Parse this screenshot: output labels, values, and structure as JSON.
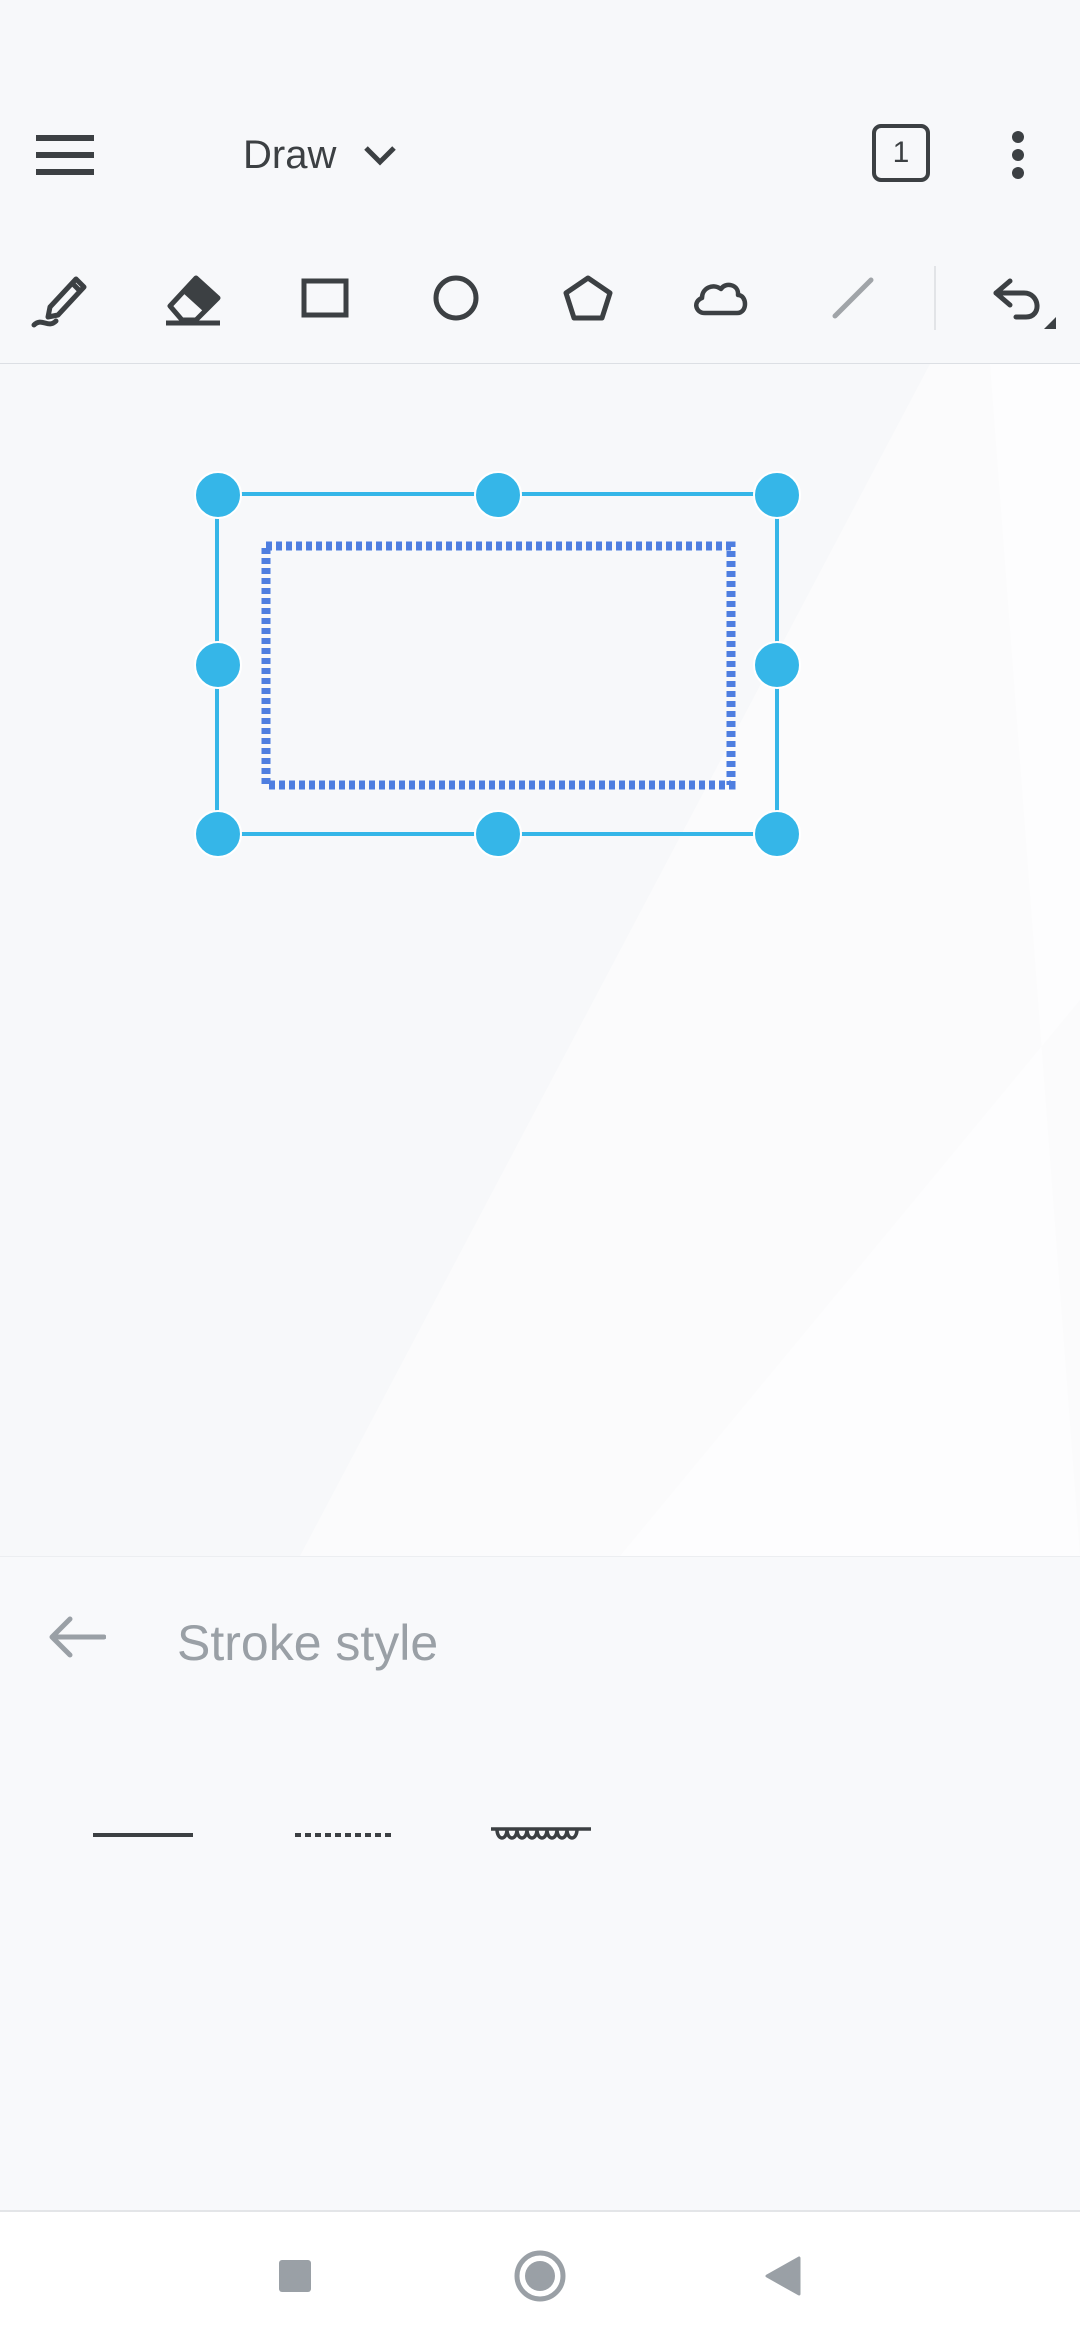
{
  "app": {
    "mode_title": "Draw",
    "page_count": "1"
  },
  "toolbar": {
    "tools": [
      "pen",
      "eraser",
      "rectangle",
      "ellipse",
      "polygon",
      "cloud",
      "line"
    ],
    "selected_shape": "rectangle"
  },
  "panel": {
    "title": "Stroke style",
    "options": [
      "solid",
      "dashed",
      "wavy"
    ]
  },
  "colors": {
    "selection": "#35b6e8",
    "shape_stroke": "#4e7ee0",
    "icon": "#3c4043",
    "muted": "#9aa0a6"
  },
  "navigation": [
    "recent-apps",
    "home",
    "back"
  ]
}
